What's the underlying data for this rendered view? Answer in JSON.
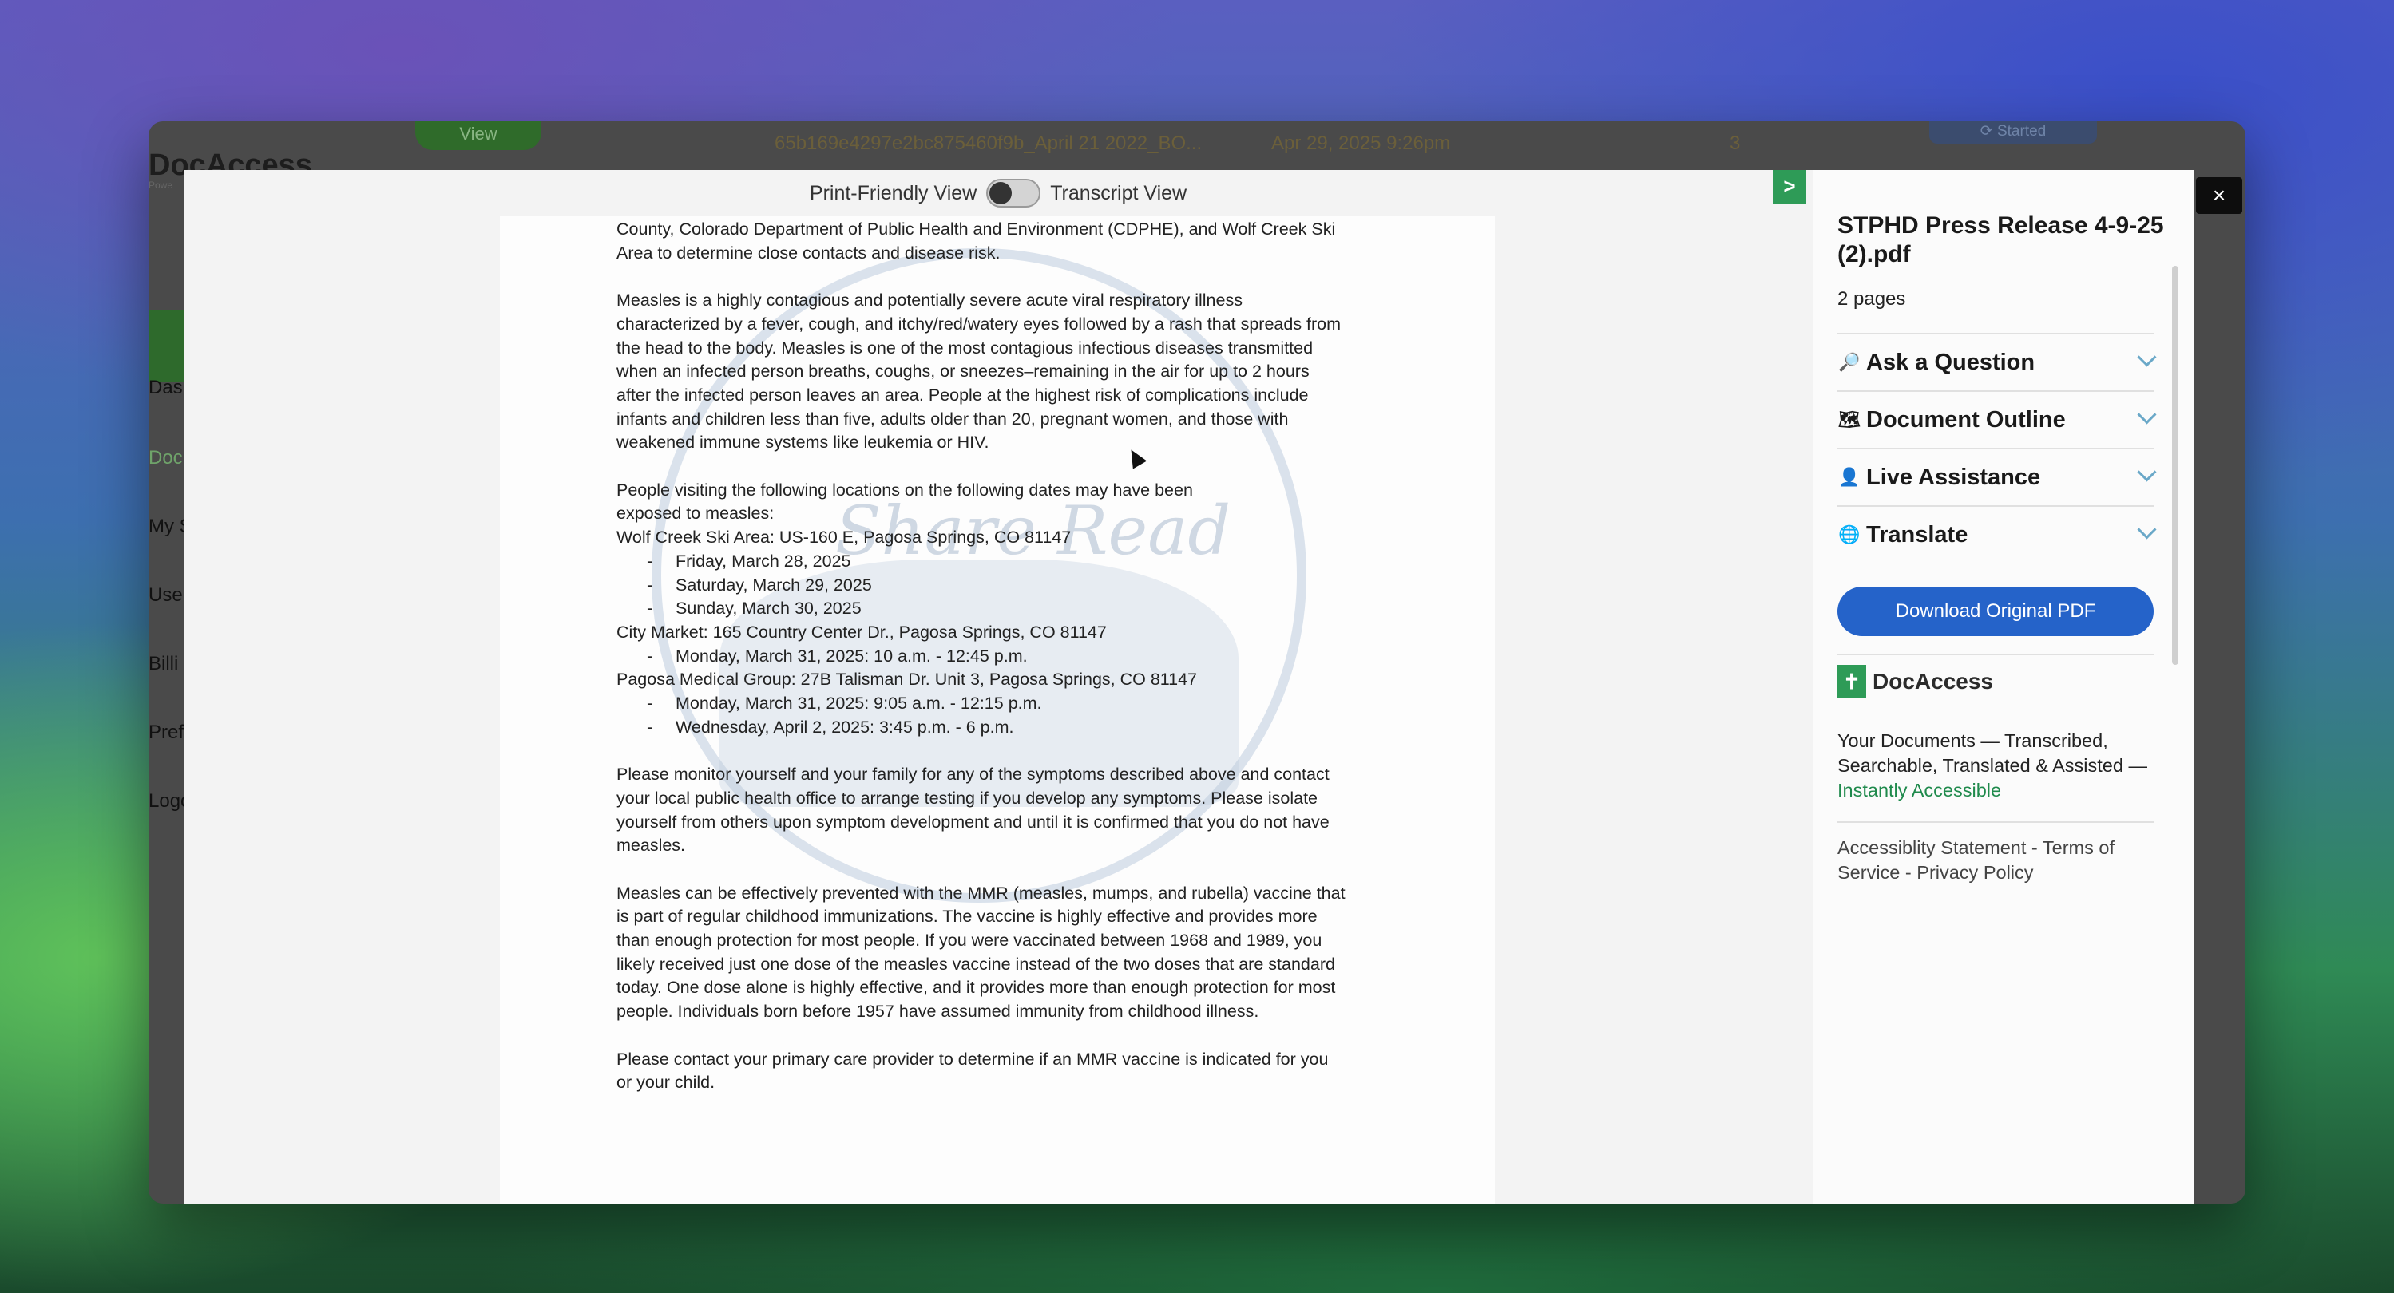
{
  "background_app": {
    "view_label": "View",
    "filename": "65b169e4297e2bc875460f9b_April 21 2022_BO...",
    "date": "Apr 29, 2025 9:26pm",
    "count": "3",
    "status": "Started",
    "logo": "DocAccess",
    "logo_sub": "Powe",
    "sidebar_fragments": [
      "Dash",
      "Doc",
      "My S",
      "User",
      "Billi",
      "Pref",
      "Logo"
    ]
  },
  "viewer": {
    "toggle_left": "Print-Friendly View",
    "toggle_right": "Transcript View",
    "expand_label": ">",
    "close_label": "×"
  },
  "document": {
    "watermark": "Share Read",
    "para1": [
      "County, Colorado Department of Public Health and Environment (CDPHE),  and Wolf Creek Ski",
      "Area to determine close contacts and disease risk."
    ],
    "para2": [
      "Measles is a highly contagious and potentially severe acute viral respiratory illness",
      "characterized by a fever, cough, and itchy/red/watery eyes followed by a rash that spreads from",
      "the head to the body. Measles is one of the most contagious infectious diseases transmitted",
      "when an infected person breaths, coughs, or sneezes–remaining in the air for up to 2 hours",
      "after the infected person leaves an area. People at the highest risk of complications include",
      "infants and children less than five, adults older than 20, pregnant women, and those with",
      "weakened immune systems like leukemia or HIV."
    ],
    "para3_intro": [
      "People visiting the following locations on the following dates may have been",
      "exposed to measles:"
    ],
    "loc1": "Wolf Creek Ski Area: US-160 E, Pagosa Springs, CO 81147",
    "loc1_dates": [
      "Friday, March 28, 2025",
      "Saturday, March 29, 2025",
      "Sunday, March 30, 2025"
    ],
    "loc2": "City Market: 165 Country Center Dr., Pagosa Springs, CO 81147",
    "loc2_dates": [
      "Monday, March 31, 2025: 10 a.m. - 12:45 p.m."
    ],
    "loc3": "Pagosa Medical Group: 27B Talisman Dr. Unit 3, Pagosa Springs, CO 81147",
    "loc3_dates": [
      "Monday, March 31, 2025: 9:05 a.m. - 12:15 p.m.",
      "Wednesday, April 2, 2025: 3:45 p.m. - 6 p.m."
    ],
    "para4": [
      "Please monitor yourself and your family for any of the symptoms described above and contact",
      "your local public health office to arrange testing if you develop any symptoms. Please isolate",
      "yourself from others upon symptom development and until it is confirmed that you do not have",
      "measles."
    ],
    "para5": [
      "Measles can be effectively prevented with the MMR (measles, mumps, and rubella) vaccine that",
      "is part of regular childhood immunizations. The vaccine is highly effective and provides more",
      "than enough protection for most people. If you were vaccinated between 1968 and 1989, you",
      "likely received just one dose of the measles vaccine instead of the two doses that are standard",
      "today. One dose alone is highly effective, and it provides more than enough protection for most",
      "people. Individuals born before 1957 have assumed immunity from childhood illness."
    ],
    "para6": [
      "Please contact your primary care provider to determine if an MMR vaccine is indicated for you",
      "or your child."
    ]
  },
  "sidebar": {
    "title": "STPHD Press Release 4-9-25 (2).pdf",
    "pages": "2 pages",
    "accordions": [
      {
        "label": "Ask a Question",
        "icon": "magnifier-icon"
      },
      {
        "label": "Document Outline",
        "icon": "map-icon"
      },
      {
        "label": "Live Assistance",
        "icon": "person-icon"
      },
      {
        "label": "Translate",
        "icon": "globe-icon"
      }
    ],
    "download_label": "Download Original PDF",
    "brand_name": "DocAccess",
    "tagline_text": "Your Documents — Transcribed, Searchable, Translated & Assisted — ",
    "tagline_link": "Instantly Accessible",
    "footer_a": "Accessiblity Statement",
    "footer_sep1": " - ",
    "footer_b": "Terms of Service",
    "footer_sep2": " - ",
    "footer_c": "Privacy Policy"
  }
}
